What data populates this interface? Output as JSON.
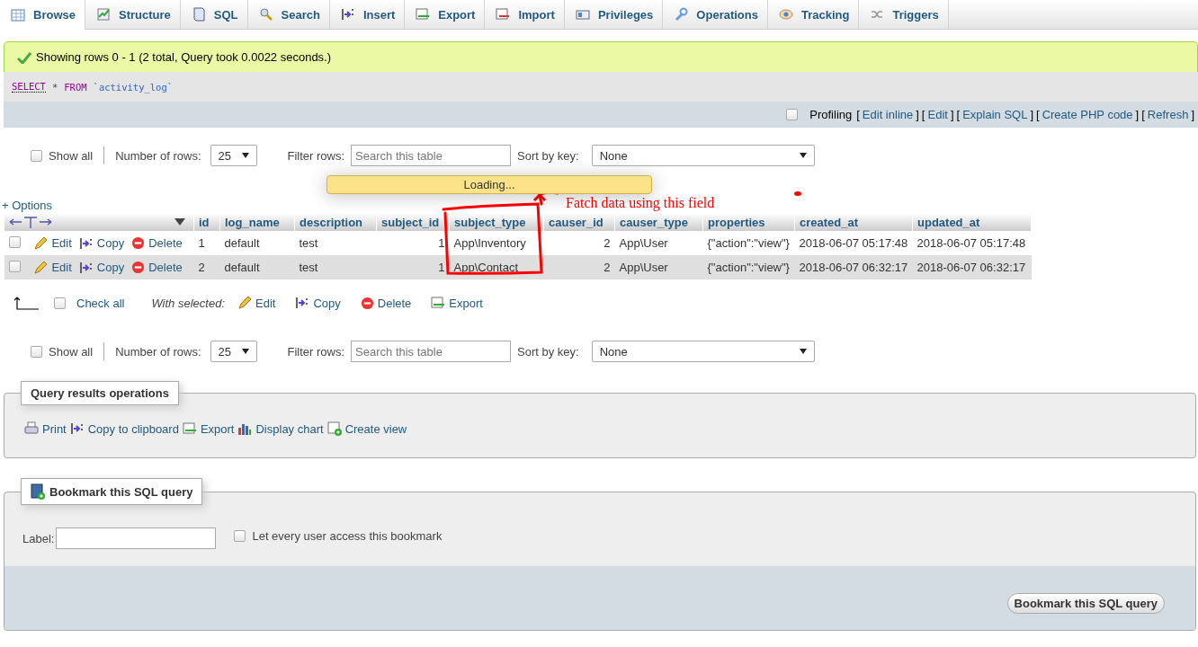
{
  "tabs": [
    {
      "label": "Browse",
      "selected": true
    },
    {
      "label": "Structure",
      "selected": false
    },
    {
      "label": "SQL",
      "selected": false
    },
    {
      "label": "Search",
      "selected": false
    },
    {
      "label": "Insert",
      "selected": false
    },
    {
      "label": "Export",
      "selected": false
    },
    {
      "label": "Import",
      "selected": false
    },
    {
      "label": "Privileges",
      "selected": false
    },
    {
      "label": "Operations",
      "selected": false
    },
    {
      "label": "Tracking",
      "selected": false
    },
    {
      "label": "Triggers",
      "selected": false
    }
  ],
  "success_message": "Showing rows 0 - 1 (2 total, Query took 0.0022 seconds.)",
  "sql_query": [
    {
      "kind": "keyword",
      "text": "SELECT"
    },
    {
      "kind": "operator",
      "text": "*"
    },
    {
      "kind": "keyword2",
      "text": "FROM"
    },
    {
      "kind": "identifier",
      "text": "`activity_log`"
    }
  ],
  "profiling": {
    "label": "Profiling",
    "checked": false,
    "links": [
      {
        "label": "Edit inline",
        "brackets": [
          "[",
          "]"
        ]
      },
      {
        "label": "Edit",
        "brackets": [
          "[",
          "]"
        ]
      },
      {
        "label": "Explain SQL",
        "brackets": [
          "[",
          "]"
        ]
      },
      {
        "label": "Create PHP code",
        "brackets": [
          "[",
          "]"
        ]
      },
      {
        "label": "Refresh",
        "brackets": [
          "[",
          "]"
        ]
      }
    ]
  },
  "nav_top": {
    "show_all": {
      "label": "Show all",
      "checked": false
    },
    "rows_label": "Number of rows:",
    "rows_value": "25",
    "filter_label": "Filter rows:",
    "filter_placeholder": "Search this table",
    "sort_label": "Sort by key:",
    "sort_value": "None"
  },
  "loading": "Loading...",
  "annotation": "Fatch data using this field",
  "options_link": "+ Options",
  "table": {
    "columns": [
      "id",
      "log_name",
      "description",
      "subject_id",
      "subject_type",
      "causer_id",
      "causer_type",
      "properties",
      "created_at",
      "updated_at"
    ],
    "rows": [
      {
        "checked": false,
        "actions": [
          "Edit",
          "Copy",
          "Delete"
        ],
        "cells": [
          "1",
          "default",
          "test",
          "1",
          "App\\Inventory",
          "2",
          "App\\User",
          "{\"action\":\"view\"}",
          "2018-06-07 05:17:48",
          "2018-06-07 05:17:48"
        ]
      },
      {
        "checked": false,
        "actions": [
          "Edit",
          "Copy",
          "Delete"
        ],
        "cells": [
          "2",
          "default",
          "test",
          "1",
          "App\\Contact",
          "2",
          "App\\User",
          "{\"action\":\"view\"}",
          "2018-06-07 06:32:17",
          "2018-06-07 06:32:17"
        ]
      }
    ]
  },
  "bulk": {
    "check_all": {
      "label": "Check all",
      "checked": false
    },
    "with_selected": "With selected:",
    "actions": [
      "Edit",
      "Copy",
      "Delete",
      "Export"
    ]
  },
  "nav_bottom": {
    "show_all": {
      "label": "Show all",
      "checked": false
    },
    "rows_label": "Number of rows:",
    "rows_value": "25",
    "filter_label": "Filter rows:",
    "filter_placeholder": "Search this table",
    "sort_label": "Sort by key:",
    "sort_value": "None"
  },
  "query_ops": {
    "legend": "Query results operations",
    "links": [
      "Print",
      "Copy to clipboard",
      "Export",
      "Display chart",
      "Create view"
    ]
  },
  "bookmark": {
    "legend": "Bookmark this SQL query",
    "label": "Label:",
    "public": {
      "label": "Let every user access this bookmark",
      "checked": false
    },
    "button": "Bookmark this SQL query"
  }
}
